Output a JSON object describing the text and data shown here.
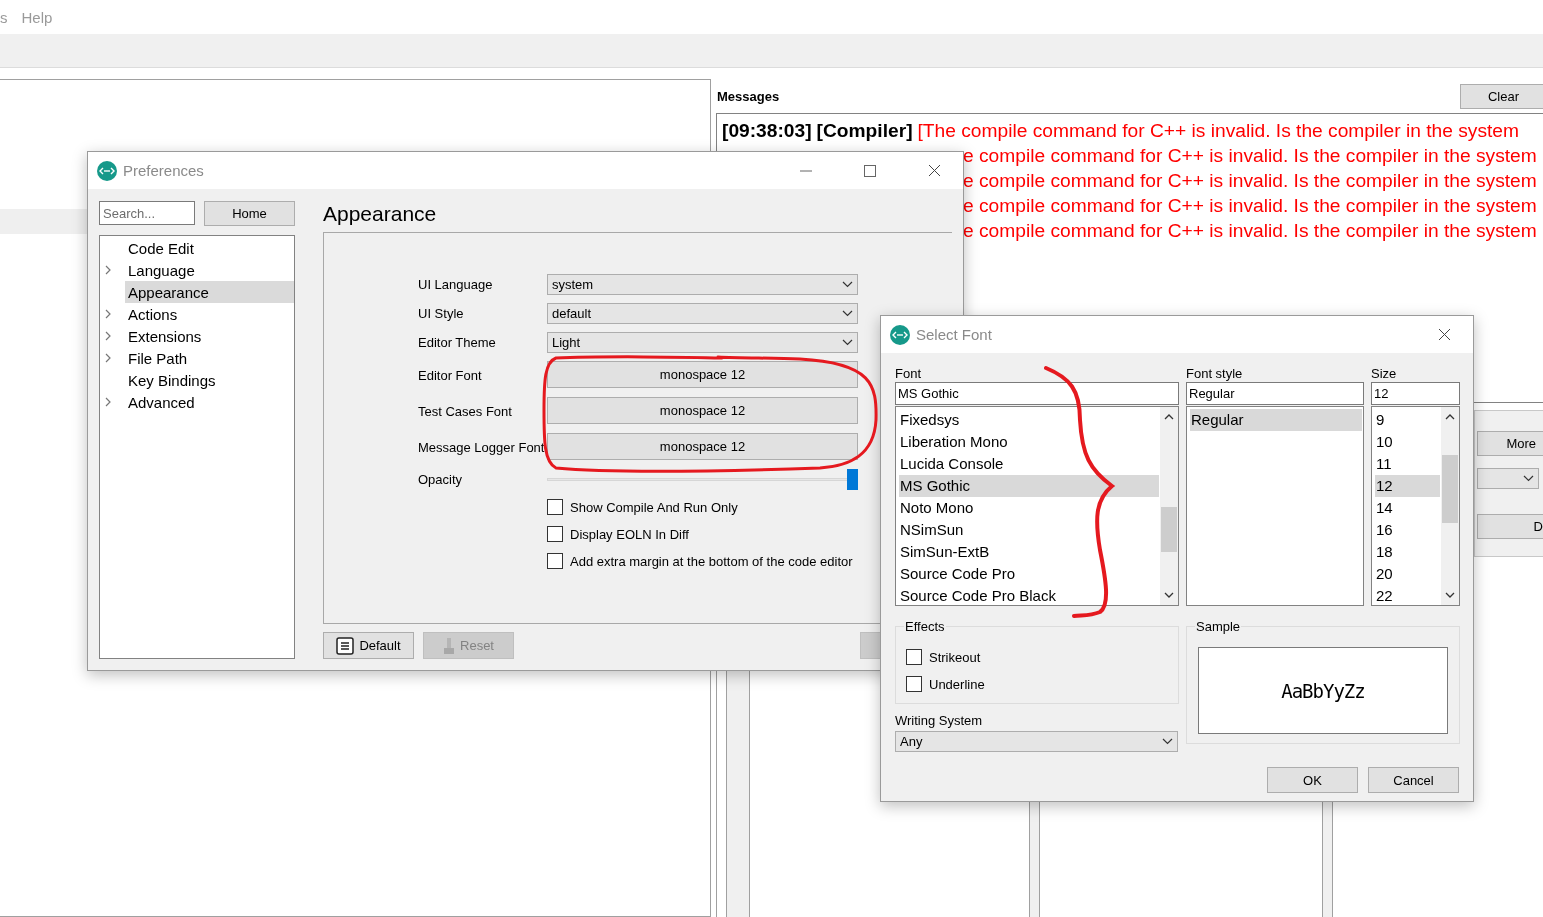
{
  "menu": [
    {
      "label": "s"
    },
    {
      "label": "Help"
    }
  ],
  "messages": {
    "title": "Messages",
    "clear": "Clear",
    "lines": [
      {
        "time": "[09:38:03]",
        "source": "[Compiler]",
        "text": "[The compile command for C++ is invalid. Is the compiler in the system"
      },
      {
        "text": "e compile command for C++ is invalid. Is the compiler in the system"
      },
      {
        "text": "e compile command for C++ is invalid. Is the compiler in the system"
      },
      {
        "text": "e compile command for C++ is invalid. Is the compiler in the system"
      },
      {
        "text": "e compile command for C++ is invalid. Is the compiler in the system"
      }
    ]
  },
  "side_panel": {
    "more": "More",
    "cut_button": "D"
  },
  "preferences": {
    "title": "Preferences",
    "search_placeholder": "Search...",
    "home": "Home",
    "tree": [
      {
        "label": "Code Edit",
        "expandable": false,
        "selected": false
      },
      {
        "label": "Language",
        "expandable": true,
        "selected": false
      },
      {
        "label": "Appearance",
        "expandable": false,
        "selected": true
      },
      {
        "label": "Actions",
        "expandable": true,
        "selected": false
      },
      {
        "label": "Extensions",
        "expandable": true,
        "selected": false
      },
      {
        "label": "File Path",
        "expandable": true,
        "selected": false
      },
      {
        "label": "Key Bindings",
        "expandable": false,
        "selected": false
      },
      {
        "label": "Advanced",
        "expandable": true,
        "selected": false
      }
    ],
    "page_title": "Appearance",
    "settings": [
      {
        "kind": "select",
        "label": "UI Language",
        "value": "system"
      },
      {
        "kind": "select",
        "label": "UI Style",
        "value": "default"
      },
      {
        "kind": "select",
        "label": "Editor Theme",
        "value": "Light"
      },
      {
        "kind": "button",
        "label": "Editor Font",
        "value": "monospace 12"
      },
      {
        "kind": "button",
        "label": "Test Cases Font",
        "value": "monospace 12"
      },
      {
        "kind": "button",
        "label": "Message Logger Font",
        "value": "monospace 12"
      },
      {
        "kind": "slider",
        "label": "Opacity",
        "level": 1
      }
    ],
    "checkboxes": [
      {
        "label": "Show Compile And Run Only",
        "checked": false
      },
      {
        "label": "Display EOLN In Diff",
        "checked": false
      },
      {
        "label": "Add extra margin at the bottom of the code editor",
        "checked": false
      }
    ],
    "buttons": [
      {
        "label": "Default",
        "disabled": false
      },
      {
        "label": "Reset",
        "disabled": true
      }
    ]
  },
  "select_font": {
    "title": "Select Font",
    "columns": [
      {
        "label": "Font",
        "value": "MS Gothic",
        "scroll": true,
        "items": [
          {
            "label": "Fixedsys",
            "selected": false
          },
          {
            "label": "Liberation Mono",
            "selected": false
          },
          {
            "label": "Lucida Console",
            "selected": false
          },
          {
            "label": "MS Gothic",
            "selected": true
          },
          {
            "label": "Noto Mono",
            "selected": false
          },
          {
            "label": "NSimSun",
            "selected": false
          },
          {
            "label": "SimSun-ExtB",
            "selected": false
          },
          {
            "label": "Source Code Pro",
            "selected": false
          },
          {
            "label": "Source Code Pro Black",
            "selected": false
          }
        ]
      },
      {
        "label": "Font style",
        "value": "Regular",
        "scroll": false,
        "items": [
          {
            "label": "Regular",
            "selected": true
          }
        ]
      },
      {
        "label": "Size",
        "value": "12",
        "scroll": true,
        "items": [
          {
            "label": "9",
            "selected": false
          },
          {
            "label": "10",
            "selected": false
          },
          {
            "label": "11",
            "selected": false
          },
          {
            "label": "12",
            "selected": true
          },
          {
            "label": "14",
            "selected": false
          },
          {
            "label": "16",
            "selected": false
          },
          {
            "label": "18",
            "selected": false
          },
          {
            "label": "20",
            "selected": false
          },
          {
            "label": "22",
            "selected": false
          }
        ]
      }
    ],
    "effects": {
      "title": "Effects",
      "options": [
        {
          "label": "Strikeout",
          "checked": false
        },
        {
          "label": "Underline",
          "checked": false
        }
      ]
    },
    "writing_system": {
      "label": "Writing System",
      "value": "Any"
    },
    "sample": {
      "title": "Sample",
      "text": "AaBbYyZz"
    },
    "buttons": [
      "OK",
      "Cancel"
    ]
  }
}
